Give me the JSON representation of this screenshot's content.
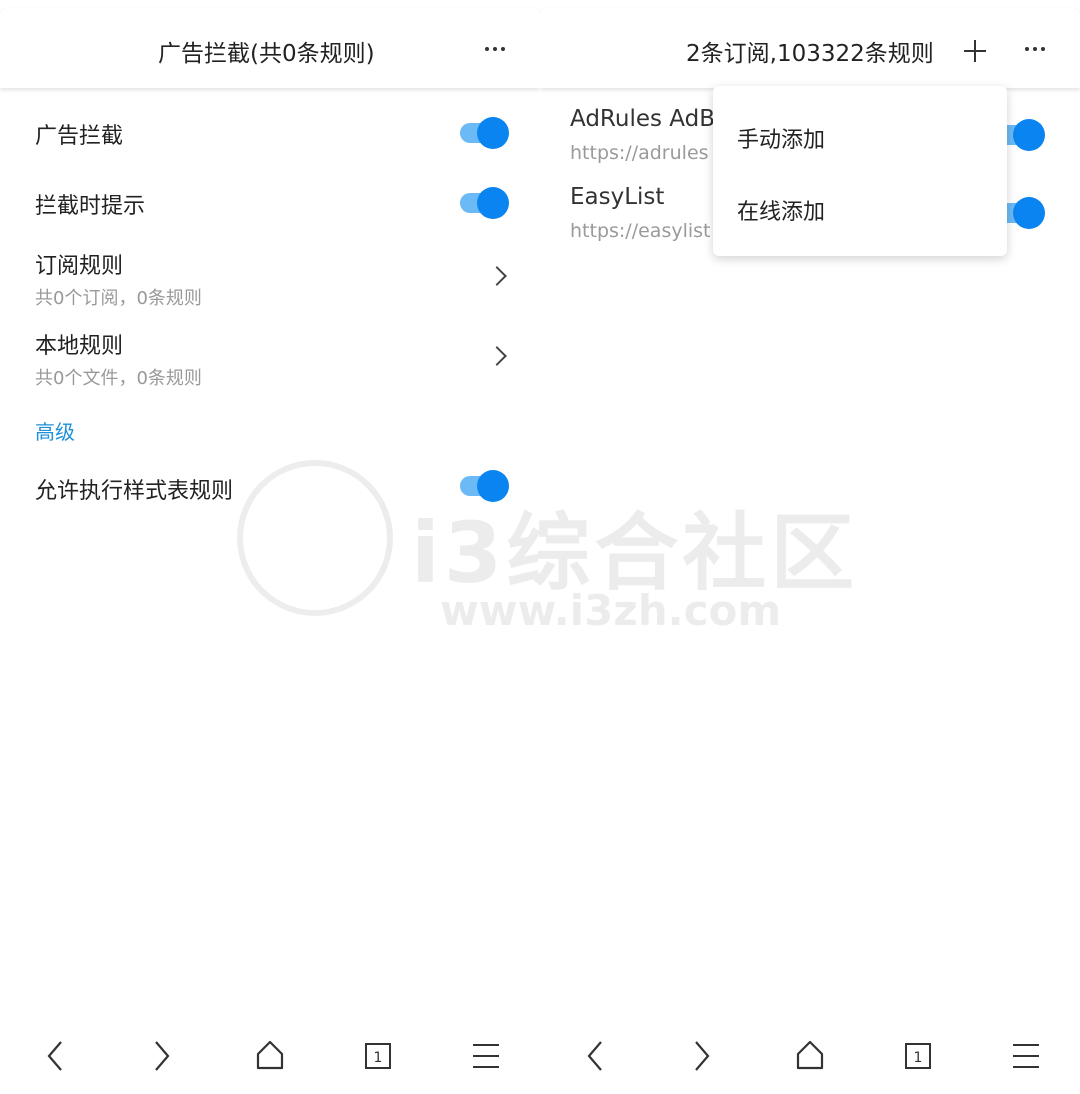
{
  "left_panel": {
    "header": {
      "title": "广告拦截(共0条规则)",
      "more_icon": "more-horizontal-icon"
    },
    "settings": [
      {
        "label": "广告拦截",
        "toggle": true
      },
      {
        "label": "拦截时提示",
        "toggle": true
      }
    ],
    "nav_rows": [
      {
        "label": "订阅规则",
        "sub": "共0个订阅，0条规则"
      },
      {
        "label": "本地规则",
        "sub": "共0个文件，0条规则"
      }
    ],
    "section": {
      "label": "高级"
    },
    "advanced": [
      {
        "label": "允许执行样式表规则",
        "toggle": true
      }
    ]
  },
  "right_panel": {
    "header": {
      "title": "2条订阅,103322条规则",
      "add_icon": "plus-icon",
      "more_icon": "more-horizontal-icon"
    },
    "subscriptions": [
      {
        "name": "AdRules AdB",
        "url": "https://adrules",
        "enabled": true
      },
      {
        "name": "EasyList",
        "url": "https://easylist",
        "enabled": true
      }
    ],
    "menu": {
      "items": [
        "手动添加",
        "在线添加"
      ]
    }
  },
  "bottom_bar": {
    "icons": [
      "back-arrow-icon",
      "forward-arrow-icon",
      "home-icon",
      "tabs-icon",
      "menu-icon"
    ],
    "tab_count": "1"
  },
  "watermark": {
    "brand": "i3综合社区",
    "url": "www.i3zh.com"
  },
  "colors": {
    "accent": "#0a84f0",
    "toggle_track": "#6bb9f5",
    "section": "#1e8fd8",
    "subtext": "#999999"
  }
}
